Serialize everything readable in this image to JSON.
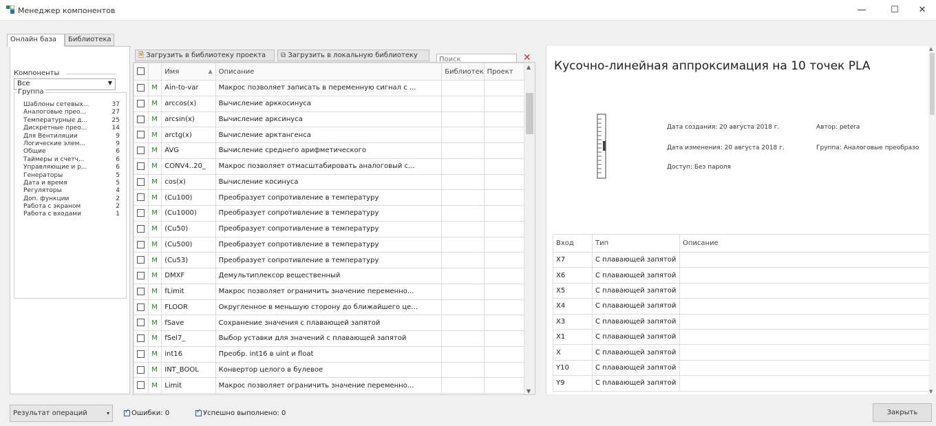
{
  "window": {
    "title": "Менеджер компонентов",
    "minimize": "—",
    "maximize": "☐",
    "close": "✕"
  },
  "tabs": [
    {
      "label": "Онлайн база"
    },
    {
      "label": "Библиотека"
    }
  ],
  "left": {
    "components_label": "Компоненты",
    "components_value": "Все",
    "group_label": "Группа",
    "groups": [
      {
        "name": "Шаблоны сетевых...",
        "count": "37"
      },
      {
        "name": "Аналоговые прео...",
        "count": "27"
      },
      {
        "name": "Температурные д...",
        "count": "25"
      },
      {
        "name": "Дискретные прео...",
        "count": "14"
      },
      {
        "name": "Для Вентиляции",
        "count": "9"
      },
      {
        "name": "Логические элем...",
        "count": "9"
      },
      {
        "name": "Общие",
        "count": "6"
      },
      {
        "name": "Таймеры и счетч...",
        "count": "6"
      },
      {
        "name": "Управляющие и р...",
        "count": "6"
      },
      {
        "name": "Генераторы",
        "count": "5"
      },
      {
        "name": "Дата и время",
        "count": "5"
      },
      {
        "name": "Регуляторы",
        "count": "4"
      },
      {
        "name": "Доп. функции",
        "count": "2"
      },
      {
        "name": "Работа с экраном",
        "count": "2"
      },
      {
        "name": "Работа с входами",
        "count": "1"
      }
    ]
  },
  "toolbar": {
    "load_project": "Загрузить в библиотеку проекта",
    "load_local": "Загрузить в локальную библиотеку",
    "search_placeholder": "Поиск"
  },
  "grid": {
    "col_name": "Имя",
    "col_desc": "Описание",
    "col_lib": "Библиотек",
    "col_proj": "Проект",
    "rows": [
      {
        "m": "M",
        "name": "Ain-to-var",
        "desc": "Макрос позволяет записать в переменную сигнал с ..."
      },
      {
        "m": "M",
        "name": "arccos(x)",
        "desc": "Вычисление арккосинуса"
      },
      {
        "m": "M",
        "name": "arcsin(x)",
        "desc": "Вычисление арксинуса"
      },
      {
        "m": "M",
        "name": "arctg(x)",
        "desc": "Вычисление арктангенса"
      },
      {
        "m": "M",
        "name": "AVG",
        "desc": "Вычисление среднего арифметического"
      },
      {
        "m": "M",
        "name": "CONV4..20_",
        "desc": "Макрос позволяет отмасштабировать аналоговый с..."
      },
      {
        "m": "M",
        "name": "cos(x)",
        "desc": "Вычисление косинуса"
      },
      {
        "m": "M",
        "name": "(Cu100)",
        "desc": "Преобразует сопротивление в температуру"
      },
      {
        "m": "M",
        "name": "(Cu1000)",
        "desc": "Преобразует сопротивление в температуру"
      },
      {
        "m": "M",
        "name": "(Cu50)",
        "desc": "Преобразует сопротивление в температуру"
      },
      {
        "m": "M",
        "name": "(Cu500)",
        "desc": "Преобразует сопротивление в температуру"
      },
      {
        "m": "M",
        "name": "(Cu53)",
        "desc": "Преобразует сопротивление в температуру"
      },
      {
        "m": "M",
        "name": "DMXF",
        "desc": "Демультиплексор вещественный"
      },
      {
        "m": "M",
        "name": "fLimit",
        "desc": "Макрос позволяет ограничить значение переменно..."
      },
      {
        "m": "M",
        "name": "FLOOR",
        "desc": "Округленное в меньшую сторону до ближайшего це..."
      },
      {
        "m": "M",
        "name": "fSave",
        "desc": "Сохранение значения с плавающей запятой"
      },
      {
        "m": "M",
        "name": "fSel7_",
        "desc": "Выбор уставки для значений с плавающей запятой"
      },
      {
        "m": "M",
        "name": "int16",
        "desc": "Преобр. int16 в uint и float"
      },
      {
        "m": "M",
        "name": "INT_BOOL",
        "desc": "Конвертор целого в булевое"
      },
      {
        "m": "M",
        "name": "Limit",
        "desc": "Макрос позволяет ограничить значение переменно..."
      }
    ]
  },
  "details": {
    "title": "Кусочно-линейная аппроксимация на 10 точек PLA",
    "created": "Дата создания: 20 августа 2018 г.",
    "modified": "Дата изменения: 20 августа 2018 г.",
    "author": "Автор: petera",
    "group": "Группа: Аналоговые преобразо",
    "access": "Доступ: Без пароля",
    "col_input": "Вход",
    "col_type": "Тип",
    "col_desc": "Описание",
    "inputs": [
      {
        "name": "X7",
        "type": "С плавающей запятой"
      },
      {
        "name": "X6",
        "type": "С плавающей запятой"
      },
      {
        "name": "X5",
        "type": "С плавающей запятой"
      },
      {
        "name": "X4",
        "type": "С плавающей запятой"
      },
      {
        "name": "X3",
        "type": "С плавающей запятой"
      },
      {
        "name": "X1",
        "type": "С плавающей запятой"
      },
      {
        "name": "X",
        "type": "С плавающей запятой"
      },
      {
        "name": "Y10",
        "type": "С плавающей запятой"
      },
      {
        "name": "Y9",
        "type": "С плавающей запятой"
      }
    ]
  },
  "bottom": {
    "result_label": "Результат операций",
    "errors": "Ошибки: 0",
    "success": "Успешно выполнено: 0",
    "close_button": "Закрыть"
  }
}
